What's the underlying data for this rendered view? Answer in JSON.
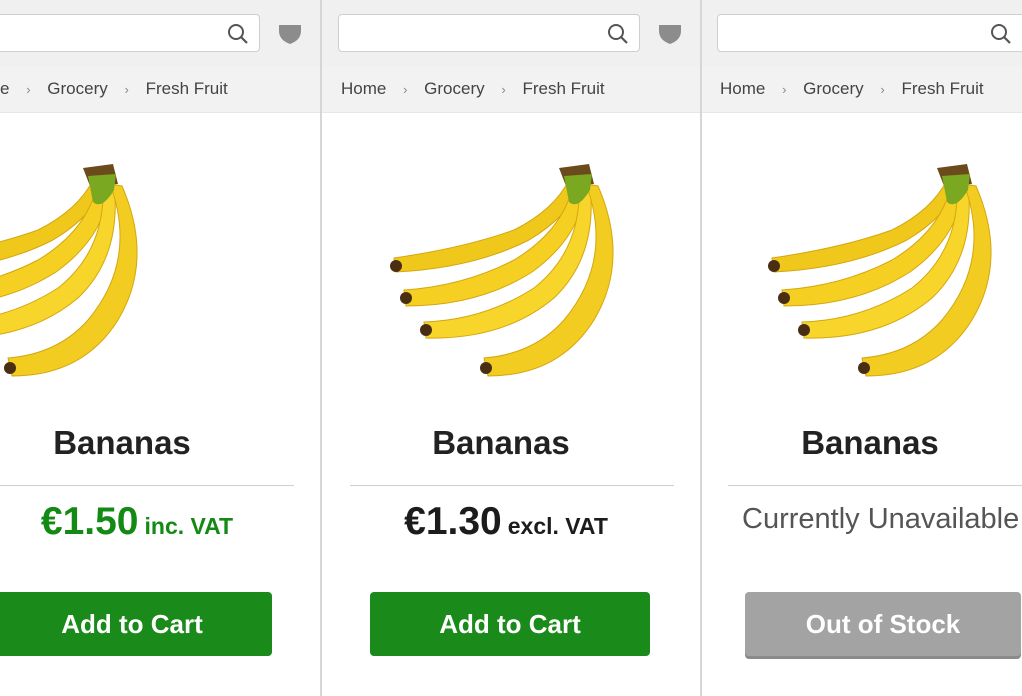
{
  "panels": [
    {
      "breadcrumb": [
        "e",
        "Grocery",
        "Fresh Fruit"
      ],
      "title": "Bananas",
      "price": "€1.50",
      "vat": "inc. VAT",
      "button": "Add to Cart"
    },
    {
      "breadcrumb": [
        "Home",
        "Grocery",
        "Fresh Fruit"
      ],
      "title": "Bananas",
      "price": "€1.30",
      "vat": "excl. VAT",
      "button": "Add to Cart"
    },
    {
      "breadcrumb": [
        "Home",
        "Grocery",
        "Fresh Fruit"
      ],
      "title": "Bananas",
      "status": "Currently Unavailable",
      "button": "Out of Stock"
    }
  ],
  "separator": "›",
  "colors": {
    "accent_green": "#1a8a1a",
    "price_green": "#138a13",
    "disabled_grey": "#a3a3a3"
  },
  "icons": {
    "search": "search-icon",
    "shield": "shield-icon"
  }
}
